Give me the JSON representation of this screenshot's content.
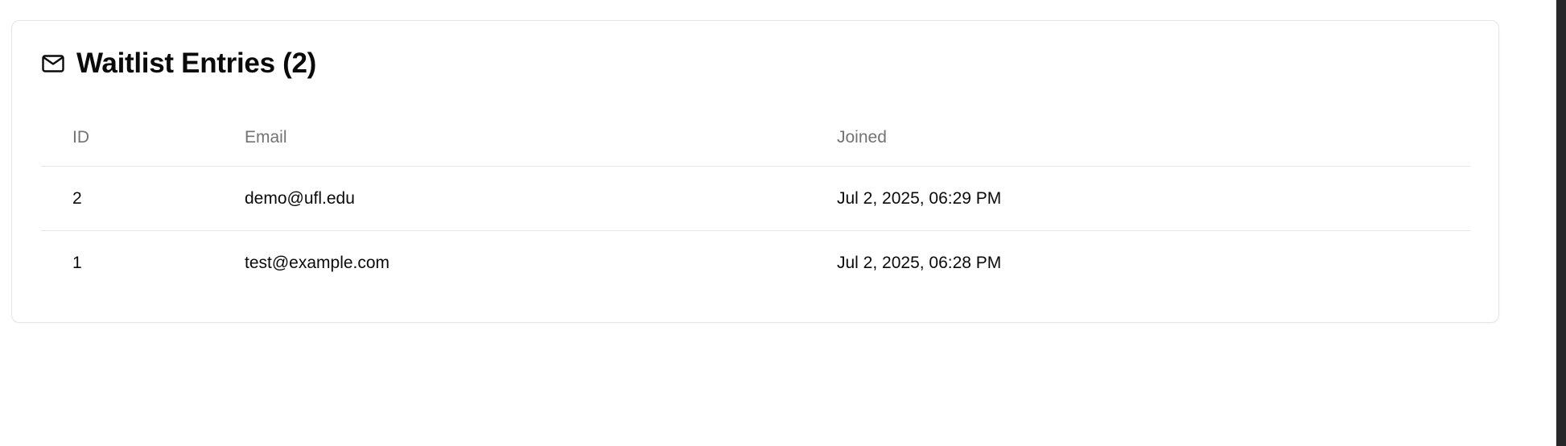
{
  "card": {
    "icon": "mail-icon",
    "title": "Waitlist Entries (2)"
  },
  "table": {
    "columns": {
      "id": "ID",
      "email": "Email",
      "joined": "Joined"
    },
    "rows": [
      {
        "id": "2",
        "email": "demo@ufl.edu",
        "joined": "Jul 2, 2025, 06:29 PM"
      },
      {
        "id": "1",
        "email": "test@example.com",
        "joined": "Jul 2, 2025, 06:28 PM"
      }
    ]
  }
}
